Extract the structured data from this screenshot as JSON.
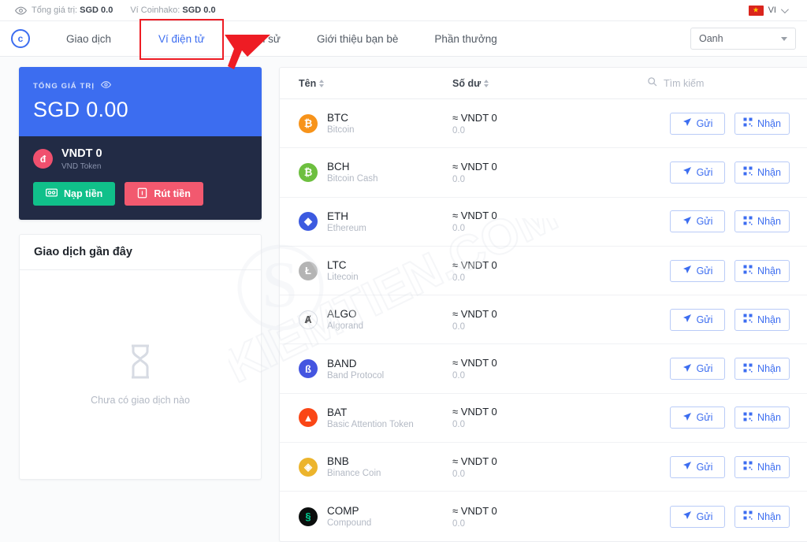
{
  "topbar": {
    "eye_icon": "eye-icon",
    "total_value_label": "Tổng giá trị:",
    "total_value": "SGD 0.0",
    "wallet_label": "Ví Coinhako:",
    "wallet_value": "SGD 0.0",
    "language": "VI",
    "flag_icon": "vietnam-flag-icon",
    "chevron_icon": "chevron-down-icon"
  },
  "nav": {
    "logo_text": "c",
    "items": [
      {
        "label": "Giao dịch",
        "active": false
      },
      {
        "label": "Ví điện tử",
        "active": true
      },
      {
        "label": "Lịch sử",
        "active": false
      },
      {
        "label": "Giới thiệu bạn bè",
        "active": false
      },
      {
        "label": "Phần thưởng",
        "active": false
      }
    ],
    "account": "Oanh",
    "highlight_color": "#ee1c24"
  },
  "balance_card": {
    "label": "TỔNG GIÁ TRỊ",
    "eye_icon": "eye-icon",
    "amount": "SGD 0.00",
    "token_badge": "đ",
    "token_title": "VNDT 0",
    "token_subtitle": "VND Token",
    "deposit_label": "Nạp tiền",
    "withdraw_label": "Rút tiền",
    "top_color": "#3c6df0",
    "bottom_color": "#222b45",
    "deposit_color": "#10c08a",
    "withdraw_color": "#f2596f"
  },
  "recent_tx": {
    "title": "Giao dịch gần đây",
    "empty_text": "Chưa có giao dịch nào",
    "empty_icon": "hourglass-icon"
  },
  "assets": {
    "columns": {
      "name": "Tên",
      "balance": "Số dư"
    },
    "search_placeholder": "Tìm kiếm",
    "search_value": "",
    "send_label": "Gửi",
    "receive_label": "Nhận",
    "rows": [
      {
        "symbol": "BTC",
        "name": "Bitcoin",
        "balance": "≈ VNDT 0",
        "amount": "0.0",
        "color": "#f7931a",
        "fg": "#ffffff",
        "glyph": "₿"
      },
      {
        "symbol": "BCH",
        "name": "Bitcoin Cash",
        "balance": "≈ VNDT 0",
        "amount": "0.0",
        "color": "#6dbf3f",
        "fg": "#ffffff",
        "glyph": "₿"
      },
      {
        "symbol": "ETH",
        "name": "Ethereum",
        "balance": "≈ VNDT 0",
        "amount": "0.0",
        "color": "#3c5ae0",
        "fg": "#ffffff",
        "glyph": "◆"
      },
      {
        "symbol": "LTC",
        "name": "Litecoin",
        "balance": "≈ VNDT 0",
        "amount": "0.0",
        "color": "#b4b4b4",
        "fg": "#ffffff",
        "glyph": "Ł"
      },
      {
        "symbol": "ALGO",
        "name": "Algorand",
        "balance": "≈ VNDT 0",
        "amount": "0.0",
        "color": "#ffffff",
        "fg": "#111111",
        "glyph": "Ⱥ"
      },
      {
        "symbol": "BAND",
        "name": "Band Protocol",
        "balance": "≈ VNDT 0",
        "amount": "0.0",
        "color": "#4455e0",
        "fg": "#ffffff",
        "glyph": "ß"
      },
      {
        "symbol": "BAT",
        "name": "Basic Attention Token",
        "balance": "≈ VNDT 0",
        "amount": "0.0",
        "color": "#fa4616",
        "fg": "#ffffff",
        "glyph": "▲"
      },
      {
        "symbol": "BNB",
        "name": "Binance Coin",
        "balance": "≈ VNDT 0",
        "amount": "0.0",
        "color": "#ecb42c",
        "fg": "#ffffff",
        "glyph": "◈"
      },
      {
        "symbol": "COMP",
        "name": "Compound",
        "balance": "≈ VNDT 0",
        "amount": "0.0",
        "color": "#0b0e0d",
        "fg": "#00d395",
        "glyph": "§"
      }
    ]
  },
  "watermark": {
    "text": "KIEMTIEN.COM"
  }
}
